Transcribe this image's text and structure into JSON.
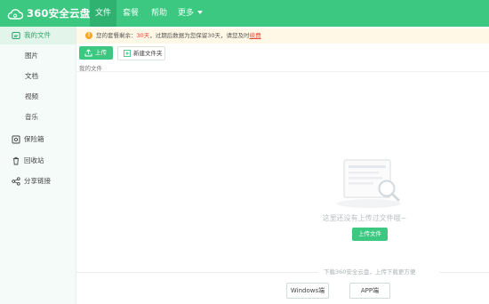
{
  "topbar": {
    "brand": "360安全云盘",
    "nav": [
      {
        "label": "文件",
        "active": true
      },
      {
        "label": "套餐",
        "active": false
      },
      {
        "label": "帮助",
        "active": false
      },
      {
        "label": "更多",
        "active": false
      }
    ],
    "accent": "#3dc882"
  },
  "sidebar": {
    "items": [
      {
        "label": "我的文件",
        "icon": "cloud-folder-icon",
        "active": true
      },
      {
        "label": "图片"
      },
      {
        "label": "文档"
      },
      {
        "label": "视频"
      },
      {
        "label": "音乐"
      },
      {
        "label": "保险箱",
        "icon": "safe-icon"
      },
      {
        "label": "回收站",
        "icon": "recycle-bin-icon"
      },
      {
        "label": "分享链接",
        "icon": "share-icon"
      }
    ]
  },
  "notice": {
    "prefix": "您的套餐剩余：",
    "days": "30天",
    "middle": "，过期后数据为您保留30天，请您及时",
    "link": "续费"
  },
  "toolbar": {
    "upload_label": "上传",
    "new_folder_label": "新建文件夹"
  },
  "breadcrumb": "我的文件",
  "empty_state": {
    "message": "这里还没有上传过文件哦~",
    "upload_button": "上传文件"
  },
  "download": {
    "text": "下载360安全云盘，上传下载更方便",
    "windows_label": "Windows端",
    "app_label": "APP端"
  }
}
